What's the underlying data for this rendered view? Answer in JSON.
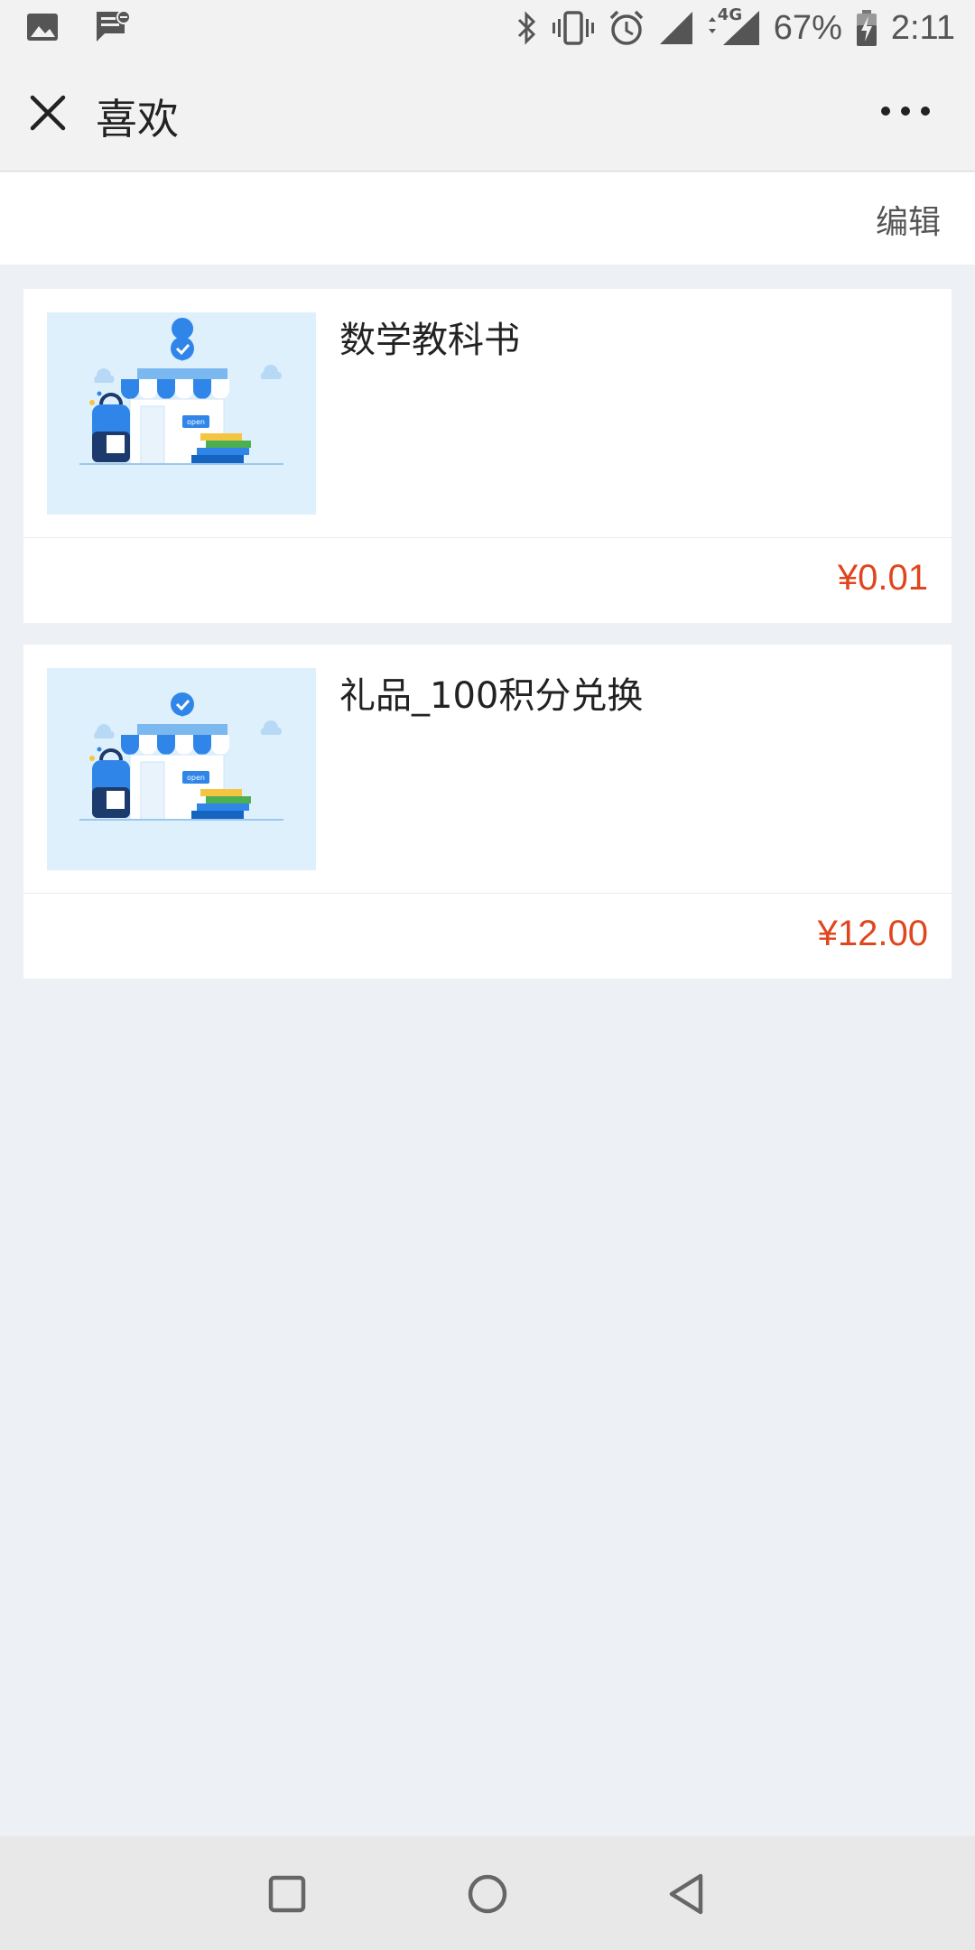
{
  "status_bar": {
    "battery": "67%",
    "time": "2:11",
    "network": "4G",
    "icons": [
      "image-icon",
      "message-icon",
      "bluetooth-icon",
      "vibrate-icon",
      "alarm-icon",
      "signal-icon",
      "battery-charging-icon"
    ]
  },
  "header": {
    "title": "喜欢",
    "close_icon": "close-icon",
    "more_icon": "more-icon"
  },
  "toolbar": {
    "edit_label": "编辑"
  },
  "items": [
    {
      "name": "数学教科书",
      "price": "¥0.01",
      "thumbnail": "shop-illustration"
    },
    {
      "name": "礼品_100积分兑换",
      "price": "¥12.00",
      "thumbnail": "shop-illustration"
    }
  ],
  "nav_bar": {
    "icons": [
      "recent-apps-icon",
      "home-icon",
      "back-icon"
    ]
  },
  "colors": {
    "price": "#e0461e",
    "background": "#edf0f5",
    "thumbnail_bg": "#dff0fd",
    "accent_blue": "#2f86e8"
  }
}
